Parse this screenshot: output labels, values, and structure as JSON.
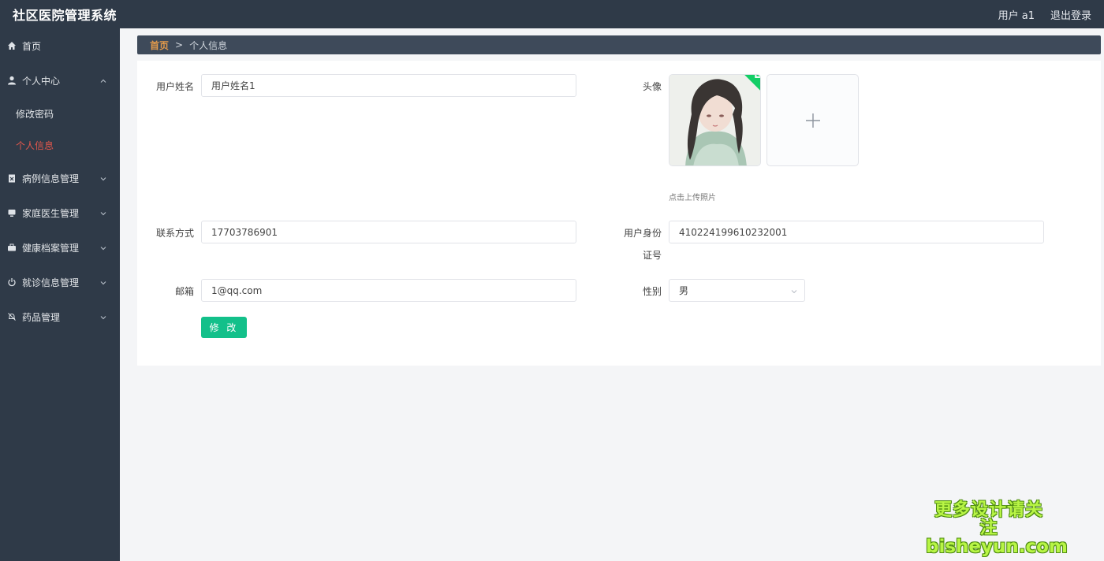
{
  "header": {
    "title": "社区医院管理系统",
    "user_label": "用户 a1",
    "logout_label": "退出登录"
  },
  "sidebar": {
    "items": [
      {
        "label": "首页",
        "icon": "home-icon"
      },
      {
        "label": "个人中心",
        "icon": "user-icon",
        "expanded": true,
        "children": [
          {
            "label": "修改密码"
          },
          {
            "label": "个人信息",
            "active": true
          }
        ]
      },
      {
        "label": "病例信息管理",
        "icon": "clipboard-icon"
      },
      {
        "label": "家庭医生管理",
        "icon": "monitor-icon"
      },
      {
        "label": "健康档案管理",
        "icon": "briefcase-icon"
      },
      {
        "label": "就诊信息管理",
        "icon": "power-icon"
      },
      {
        "label": "药品管理",
        "icon": "bell-off-icon"
      }
    ],
    "active_color": "#e2574c"
  },
  "breadcrumb": {
    "home": "首页",
    "separator": ">",
    "current": "个人信息"
  },
  "form": {
    "username": {
      "label": "用户姓名",
      "value": "用户姓名1"
    },
    "avatar": {
      "label": "头像",
      "hint": "点击上传照片"
    },
    "phone": {
      "label": "联系方式",
      "value": "17703786901"
    },
    "id_card": {
      "label_line1": "用户身份",
      "label_line2": "证号",
      "value": "410224199610232001"
    },
    "email": {
      "label": "邮箱",
      "value": "1@qq.com"
    },
    "gender": {
      "label": "性别",
      "value": "男"
    },
    "submit_label": "修 改"
  },
  "watermark": {
    "line1": "更多设计请关注",
    "line2": "bisheyun.com"
  },
  "colors": {
    "sidebar_bg": "#2f3a48",
    "primary_button": "#13c08a",
    "breadcrumb_home": "#e39a4a"
  }
}
